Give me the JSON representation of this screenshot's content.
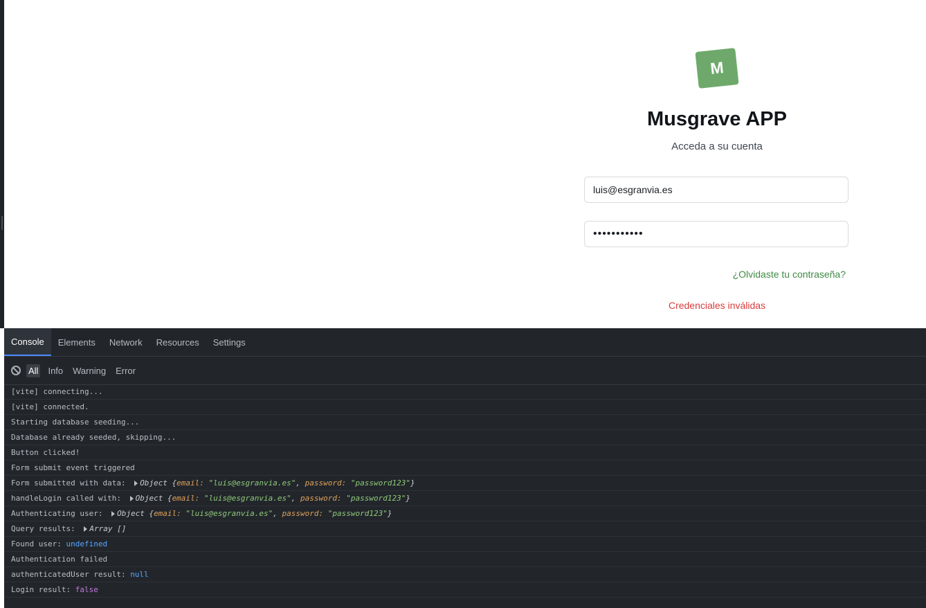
{
  "app": {
    "logo_letter": "M",
    "title": "Musgrave APP",
    "subtitle": "Acceda a su cuenta",
    "email_value": "luis@esgranvia.es",
    "password_masked": "•••••••••••",
    "forgot_link": "¿Olvidaste tu contraseña?",
    "error_message": "Credenciales inválidas",
    "colors": {
      "brand": "#6ea96b",
      "link": "#3f8a45",
      "error": "#d83b3b"
    }
  },
  "devtools": {
    "tabs": [
      "Console",
      "Elements",
      "Network",
      "Resources",
      "Settings"
    ],
    "active_tab": "Console",
    "filters": [
      "All",
      "Info",
      "Warning",
      "Error"
    ],
    "active_filter": "All",
    "clear_icon": "clear-console-icon",
    "logs": {
      "l1": "[vite] connecting...",
      "l2": "[vite] connected.",
      "l3": "Starting database seeding...",
      "l4": "Database already seeded, skipping...",
      "l5": "Button clicked!",
      "l6": "Form submit event triggered",
      "l7_prefix": "Form submitted with data: ",
      "l8_prefix": "handleLogin called with: ",
      "l9_prefix": "Authenticating user: ",
      "obj_label": "Object {",
      "obj_email_key": "email: ",
      "obj_email_val": "\"luis@esgranvia.es\"",
      "obj_sep": ", ",
      "obj_pw_key": "password: ",
      "obj_pw_val": "\"password123\"",
      "obj_close": "}",
      "l10_prefix": "Query results: ",
      "l10_value": "Array []",
      "l11_prefix": "Found user: ",
      "l11_value": "undefined",
      "l12": "Authentication failed",
      "l13_prefix": "authenticatedUser result: ",
      "l13_value": "null",
      "l14_prefix": "Login result: ",
      "l14_value": "false"
    }
  }
}
